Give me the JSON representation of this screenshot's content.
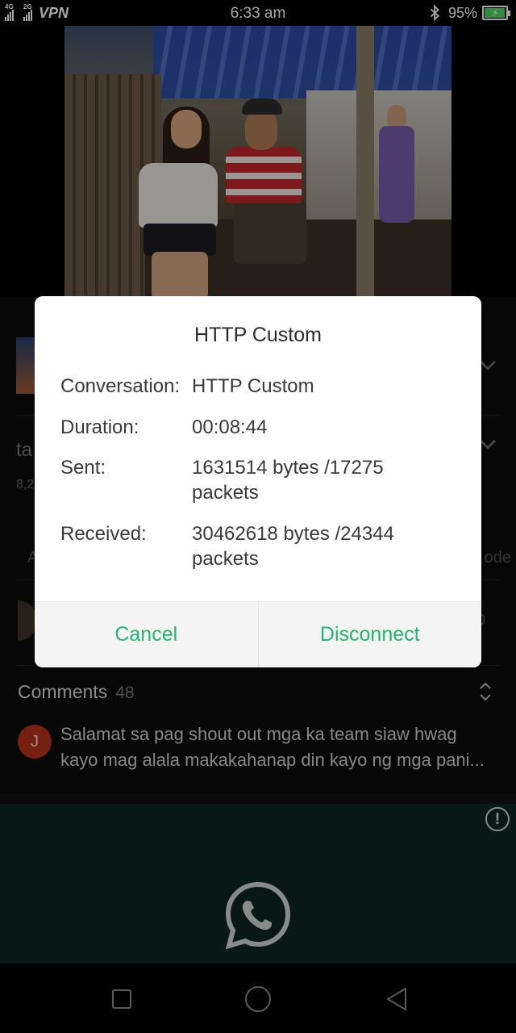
{
  "status_bar": {
    "net1": "4G",
    "net2": "2G",
    "vpn": "VPN",
    "time": "6:33 am",
    "battery": "95%",
    "battery_level": 0.95
  },
  "background": {
    "partial_title": "ta",
    "partial_views": "8,2",
    "partial_tab": "A",
    "partial_mode": "ode",
    "partial_count": "0"
  },
  "comments": {
    "title": "Comments",
    "count": "48",
    "first": {
      "avatar_letter": "J",
      "line1": "Salamat sa pag shout out mga ka team siaw hwag",
      "line2": "kayo mag alala makakahanap din kayo ng mga pani..."
    }
  },
  "ad": {
    "info_glyph": "!",
    "logo": "whatsapp-logo"
  },
  "dialog": {
    "title": "HTTP Custom",
    "conversation_label": "Conversation:",
    "conversation_value": "HTTP Custom",
    "duration_label": "Duration:",
    "duration_value": "00:08:44",
    "sent_label": "Sent:",
    "sent_value": "1631514 bytes /17275 packets",
    "received_label": "Received:",
    "received_value": "30462618 bytes /24344 packets",
    "cancel": "Cancel",
    "disconnect": "Disconnect",
    "accent_color": "#22b573"
  }
}
